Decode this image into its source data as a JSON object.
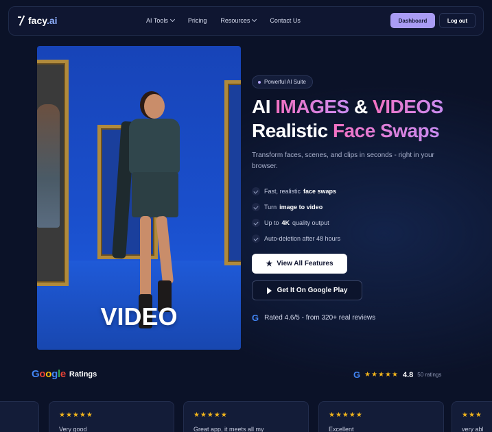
{
  "nav": {
    "logo_text": "facy",
    "logo_suffix": ".ai",
    "links": [
      {
        "label": "AI Tools",
        "dropdown": true
      },
      {
        "label": "Pricing",
        "dropdown": false
      },
      {
        "label": "Resources",
        "dropdown": true
      },
      {
        "label": "Contact Us",
        "dropdown": false
      }
    ],
    "dashboard_label": "Dashboard",
    "logout_label": "Log out"
  },
  "hero": {
    "image_overlay_text": "VIDEO",
    "pill_label": "Powerful AI Suite",
    "headline_line1": {
      "part1": "AI ",
      "part2": "IMAGES",
      "part3": " & ",
      "part4": "VIDEOS"
    },
    "headline_line2": {
      "part1": "Realistic ",
      "part2": "Face Swaps"
    },
    "subtitle": "Transform faces, scenes, and clips in seconds - right in your browser.",
    "features": [
      {
        "pre": "Fast, realistic",
        "bold": "face swaps",
        "post": ""
      },
      {
        "pre": "Turn",
        "bold": "image to video",
        "post": ""
      },
      {
        "pre": "Up to",
        "bold": "4K",
        "post": "quality output"
      },
      {
        "pre": "Auto-deletion after 48 hours",
        "bold": "",
        "post": ""
      }
    ],
    "primary_button": "View All Features",
    "secondary_button": "Get It On Google Play",
    "rated_text": "Rated 4.6/5 - from 320+ real reviews"
  },
  "ratings": {
    "google_word": "Google",
    "label": "Ratings",
    "stars": "★★★★★",
    "score": "4.8",
    "count": "50 ratings",
    "cards": [
      {
        "stars": "★★★★★",
        "text": "Very good"
      },
      {
        "stars": "★★★★★",
        "text": "Great app, it meets all my"
      },
      {
        "stars": "★★★★★",
        "text": "Excellent"
      },
      {
        "stars": "★★★",
        "text": "very abl"
      }
    ]
  },
  "colors": {
    "background": "#0b1228",
    "accent_pink": "#f271c2",
    "accent_violet": "#a99cf5",
    "star": "#f2b51c"
  }
}
